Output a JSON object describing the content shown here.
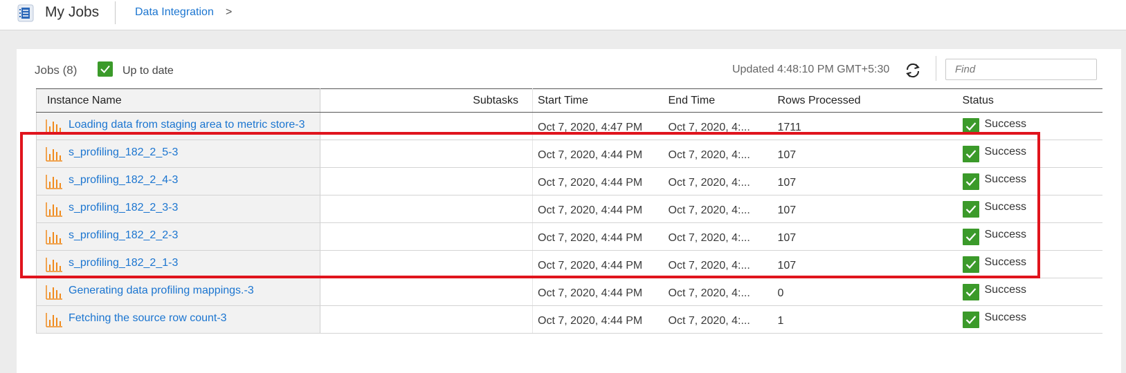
{
  "header": {
    "app_icon": "job-list-icon",
    "title": "My Jobs",
    "breadcrumb": "Data Integration",
    "breadcrumb_sep": ">"
  },
  "toolbar": {
    "jobs_count": "Jobs (8)",
    "up_to_date": "Up to date",
    "updated": "Updated 4:48:10 PM GMT+5:30",
    "refresh_icon": "refresh-icon",
    "find_placeholder": "Find"
  },
  "table": {
    "columns": {
      "name": "Instance Name",
      "subtasks": "Subtasks",
      "start": "Start Time",
      "end": "End Time",
      "rows": "Rows Processed",
      "status": "Status"
    },
    "rows": [
      {
        "name": "Loading data from staging area to metric store-3",
        "subtasks": "",
        "start": "Oct 7, 2020, 4:47 PM",
        "end": "Oct 7, 2020, 4:...",
        "rows": "1711",
        "status": "Success"
      },
      {
        "name": "s_profiling_182_2_5-3",
        "subtasks": "",
        "start": "Oct 7, 2020, 4:44 PM",
        "end": "Oct 7, 2020, 4:...",
        "rows": "107",
        "status": "Success"
      },
      {
        "name": "s_profiling_182_2_4-3",
        "subtasks": "",
        "start": "Oct 7, 2020, 4:44 PM",
        "end": "Oct 7, 2020, 4:...",
        "rows": "107",
        "status": "Success"
      },
      {
        "name": "s_profiling_182_2_3-3",
        "subtasks": "",
        "start": "Oct 7, 2020, 4:44 PM",
        "end": "Oct 7, 2020, 4:...",
        "rows": "107",
        "status": "Success"
      },
      {
        "name": "s_profiling_182_2_2-3",
        "subtasks": "",
        "start": "Oct 7, 2020, 4:44 PM",
        "end": "Oct 7, 2020, 4:...",
        "rows": "107",
        "status": "Success"
      },
      {
        "name": "s_profiling_182_2_1-3",
        "subtasks": "",
        "start": "Oct 7, 2020, 4:44 PM",
        "end": "Oct 7, 2020, 4:...",
        "rows": "107",
        "status": "Success"
      },
      {
        "name": "Generating data profiling mappings.-3",
        "subtasks": "",
        "start": "Oct 7, 2020, 4:44 PM",
        "end": "Oct 7, 2020, 4:...",
        "rows": "0",
        "status": "Success"
      },
      {
        "name": "Fetching the source row count-3",
        "subtasks": "",
        "start": "Oct 7, 2020, 4:44 PM",
        "end": "Oct 7, 2020, 4:...",
        "rows": "1",
        "status": "Success"
      }
    ]
  },
  "colors": {
    "link": "#1b75d0",
    "success": "#3b9a2a",
    "highlight": "#e0141d",
    "job_icon": "#f08a1c"
  }
}
